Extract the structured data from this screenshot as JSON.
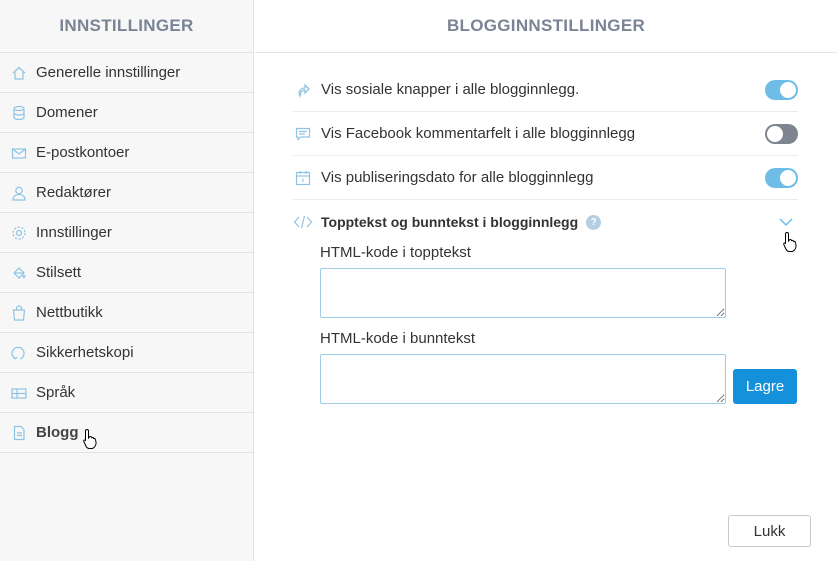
{
  "sidebar": {
    "title": "INNSTILLINGER",
    "items": [
      {
        "label": "Generelle innstillinger",
        "icon": "home-icon"
      },
      {
        "label": "Domener",
        "icon": "database-icon"
      },
      {
        "label": "E-postkontoer",
        "icon": "envelope-icon"
      },
      {
        "label": "Redaktører",
        "icon": "user-icon"
      },
      {
        "label": "Innstillinger",
        "icon": "gear-icon"
      },
      {
        "label": "Stilsett",
        "icon": "paint-bucket-icon"
      },
      {
        "label": "Nettbutikk",
        "icon": "shopping-bag-icon"
      },
      {
        "label": "Sikkerhetskopi",
        "icon": "backup-icon"
      },
      {
        "label": "Språk",
        "icon": "language-icon"
      },
      {
        "label": "Blogg",
        "icon": "document-icon",
        "active": true
      }
    ]
  },
  "main": {
    "title": "BLOGGINNSTILLINGER",
    "settings": [
      {
        "label": "Vis sosiale knapper i alle blogginnlegg.",
        "icon": "share-icon",
        "enabled": true
      },
      {
        "label": "Vis Facebook kommentarfelt i alle blogginnlegg",
        "icon": "comment-icon",
        "enabled": false
      },
      {
        "label": "Vis publiseringsdato for alle blogginnlegg",
        "icon": "calendar-icon",
        "enabled": true
      }
    ],
    "expander": {
      "label": "Topptekst og bunntekst i blogginnlegg",
      "icon": "code-icon",
      "help": "?"
    },
    "header_code": {
      "label": "HTML-kode i topptekst",
      "value": ""
    },
    "footer_code": {
      "label": "HTML-kode i bunntekst",
      "value": ""
    },
    "save_label": "Lagre",
    "close_label": "Lukk"
  },
  "colors": {
    "accent": "#1591db",
    "toggle_on": "#6dbde8",
    "toggle_off": "#7e8590",
    "header_text": "#7a8495",
    "icon": "#8fc3e3"
  }
}
